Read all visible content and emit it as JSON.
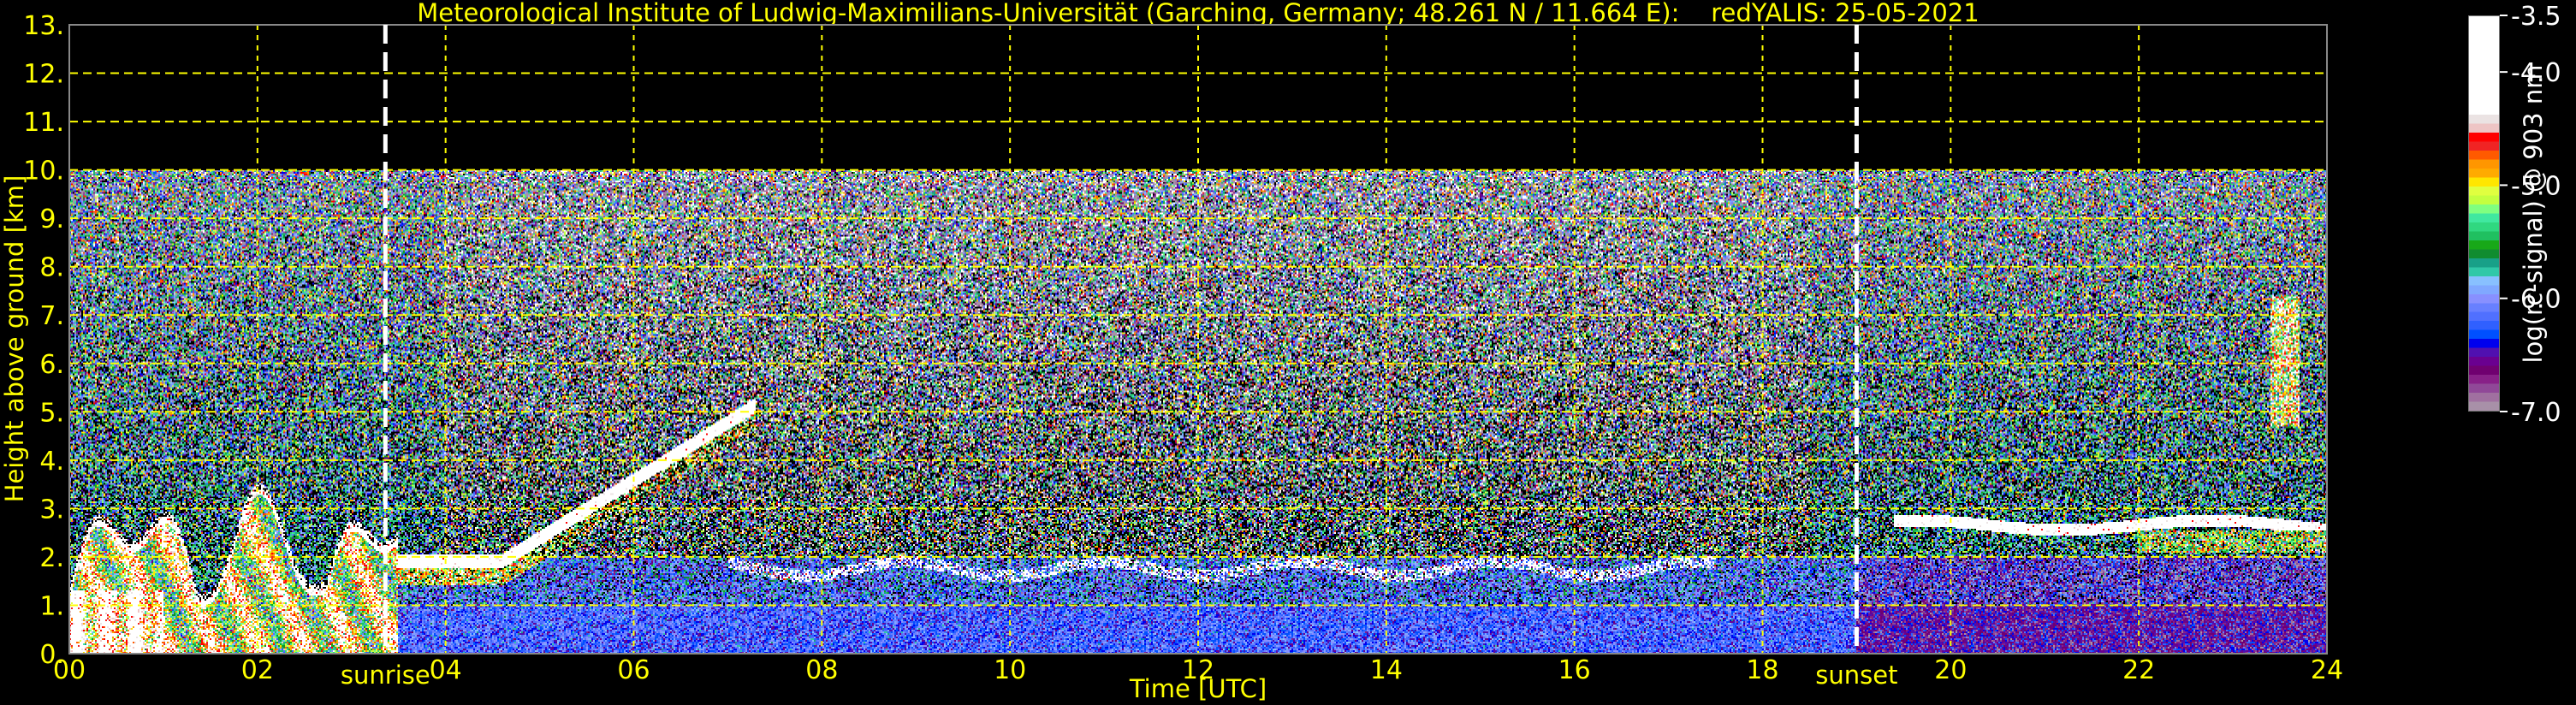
{
  "chart_data": {
    "type": "heatmap",
    "title": "Meteorological Institute of Ludwig-Maximilians-Universität (Garching, Germany; 48.261 N / 11.664 E):    redYALIS: 25-05-2021",
    "xlabel": "Time [UTC]",
    "ylabel": "Height above ground [km]",
    "xlim": [
      0,
      24
    ],
    "ylim": [
      0,
      13
    ],
    "x_ticks": [
      "00",
      "02",
      "04",
      "06",
      "08",
      "10",
      "12",
      "14",
      "16",
      "18",
      "20",
      "22",
      "24"
    ],
    "y_ticks": [
      "0.",
      "1.",
      "2.",
      "3.",
      "4.",
      "5.",
      "6.",
      "7.",
      "8.",
      "9.",
      "10.",
      "11.",
      "12.",
      "13."
    ],
    "grid": true,
    "data_max_height_km": 10,
    "colorbar": {
      "label": "log(rc-signal) @ 903 nm",
      "range": [
        -7.0,
        -3.5
      ],
      "ticks": [
        "-3.5",
        "-4.0",
        "-5.0",
        "-6.0",
        "-7.0"
      ],
      "colors_top_to_bottom": [
        "#ffffff",
        "#ebe3e3",
        "#eec5c5",
        "#ff0000",
        "#f02424",
        "#ff5a00",
        "#ff9600",
        "#ffaa00",
        "#ffe600",
        "#e0ff40",
        "#c4ff40",
        "#80ff80",
        "#40e8a0",
        "#30d880",
        "#20c060",
        "#18a818",
        "#108c30",
        "#18a088",
        "#30c8a8",
        "#88c0ff",
        "#80a8ff",
        "#8890ff",
        "#6880ff",
        "#5070ff",
        "#3060ff",
        "#0050ff",
        "#0000ee",
        "#5010b0",
        "#6a0090",
        "#700070",
        "#882088",
        "#904898",
        "#a070a0",
        "#a890a8"
      ]
    },
    "annotations": [
      {
        "label": "sunrise",
        "time_h": 3.36
      },
      {
        "label": "sunset",
        "time_h": 19.0
      }
    ]
  }
}
